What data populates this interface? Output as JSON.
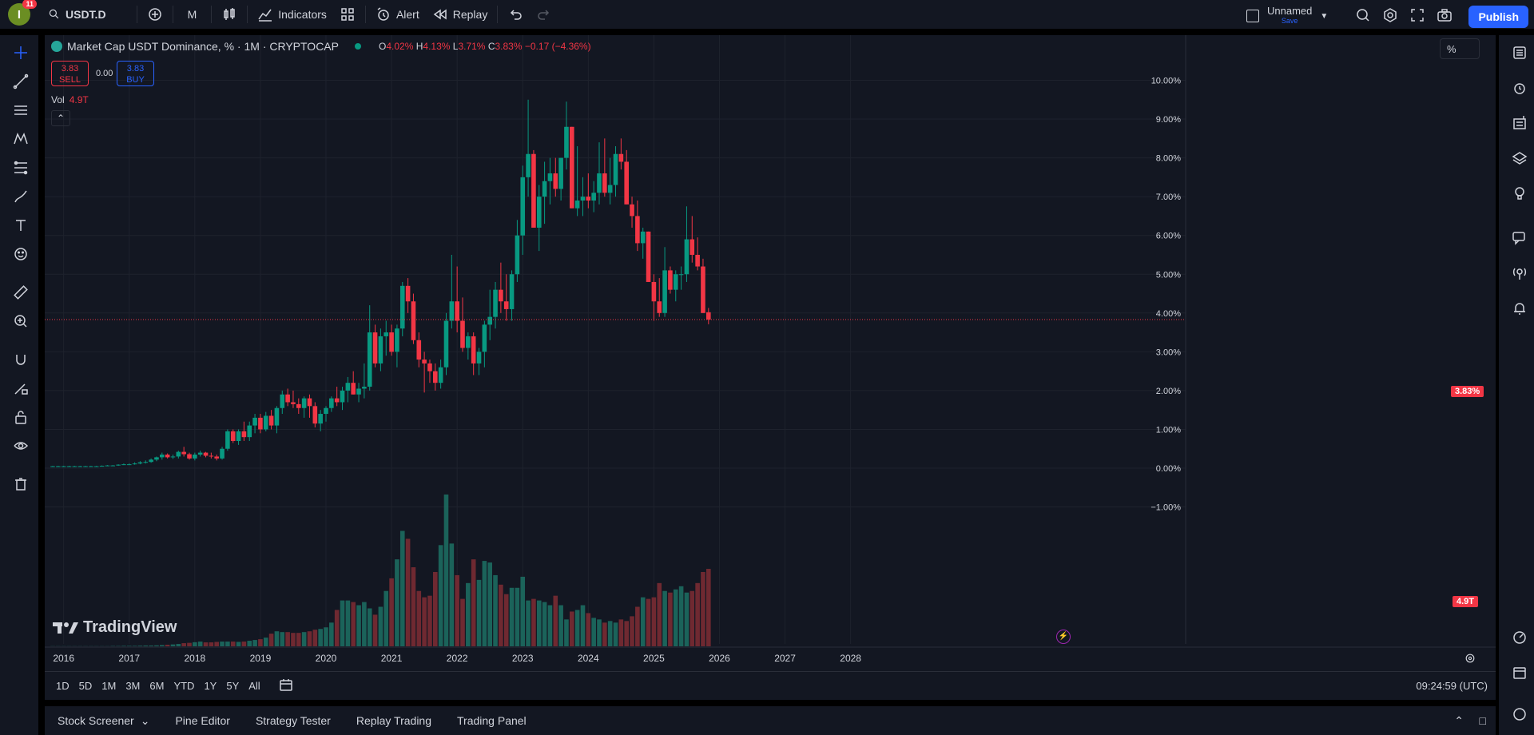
{
  "topbar": {
    "avatar_letter": "I",
    "notif_count": "11",
    "symbol": "USDT.D",
    "interval": "M",
    "indicators_label": "Indicators",
    "alert_label": "Alert",
    "replay_label": "Replay",
    "layout_name": "Unnamed",
    "save_label": "Save",
    "publish_label": "Publish"
  },
  "legend": {
    "title": "Market Cap USDT Dominance, % · 1M · CRYPTOCAP",
    "o_label": "O",
    "o": "4.02%",
    "h_label": "H",
    "h": "4.13%",
    "l_label": "L",
    "l": "3.71%",
    "c_label": "C",
    "c": "3.83%",
    "change": "−0.17 (−4.36%)",
    "sell_price": "3.83",
    "sell_label": "SELL",
    "buy_price": "3.83",
    "buy_label": "BUY",
    "spread": "0.00",
    "vol_label": "Vol",
    "vol_value": "4.9T",
    "scale_mode": "%",
    "logo_text": "TradingView"
  },
  "price_axis": {
    "labels": [
      "10.00%",
      "9.00%",
      "8.00%",
      "7.00%",
      "6.00%",
      "5.00%",
      "4.00%",
      "3.00%",
      "2.00%",
      "1.00%",
      "0.00%",
      "−1.00%"
    ],
    "last_price_tag": "3.83%",
    "volume_tag": "4.9T"
  },
  "time_axis": {
    "labels": [
      "2016",
      "2017",
      "2018",
      "2019",
      "2020",
      "2021",
      "2022",
      "2023",
      "2024",
      "2025",
      "2026",
      "2027",
      "2028"
    ]
  },
  "rangebar": {
    "ranges": [
      "1D",
      "5D",
      "1M",
      "3M",
      "6M",
      "YTD",
      "1Y",
      "5Y",
      "All"
    ],
    "clock": "09:24:59 (UTC)"
  },
  "bottom_tabs": [
    "Stock Screener",
    "Pine Editor",
    "Strategy Tester",
    "Replay Trading",
    "Trading Panel"
  ],
  "colors": {
    "up": "#089981",
    "down": "#f23645",
    "bg": "#131722",
    "grid": "#1e222d",
    "accent": "#2962ff"
  },
  "chart_data": {
    "type": "candlestick",
    "ylim": [
      -1.5,
      11
    ],
    "start": "2015-11",
    "candles": [
      [
        0.05,
        0.06,
        0.04,
        0.05
      ],
      [
        0.05,
        0.06,
        0.04,
        0.05
      ],
      [
        0.05,
        0.06,
        0.04,
        0.05
      ],
      [
        0.05,
        0.06,
        0.04,
        0.05
      ],
      [
        0.05,
        0.06,
        0.04,
        0.05
      ],
      [
        0.05,
        0.06,
        0.04,
        0.05
      ],
      [
        0.05,
        0.06,
        0.04,
        0.05
      ],
      [
        0.05,
        0.06,
        0.04,
        0.05
      ],
      [
        0.05,
        0.06,
        0.04,
        0.05
      ],
      [
        0.05,
        0.07,
        0.04,
        0.06
      ],
      [
        0.06,
        0.08,
        0.05,
        0.07
      ],
      [
        0.07,
        0.08,
        0.06,
        0.07
      ],
      [
        0.07,
        0.1,
        0.06,
        0.09
      ],
      [
        0.09,
        0.12,
        0.08,
        0.1
      ],
      [
        0.1,
        0.12,
        0.09,
        0.1
      ],
      [
        0.1,
        0.15,
        0.09,
        0.12
      ],
      [
        0.12,
        0.18,
        0.1,
        0.15
      ],
      [
        0.15,
        0.2,
        0.12,
        0.16
      ],
      [
        0.16,
        0.25,
        0.14,
        0.22
      ],
      [
        0.22,
        0.3,
        0.18,
        0.28
      ],
      [
        0.28,
        0.4,
        0.22,
        0.35
      ],
      [
        0.35,
        0.38,
        0.25,
        0.28
      ],
      [
        0.28,
        0.35,
        0.24,
        0.3
      ],
      [
        0.3,
        0.45,
        0.25,
        0.42
      ],
      [
        0.42,
        0.55,
        0.3,
        0.36
      ],
      [
        0.36,
        0.4,
        0.22,
        0.25
      ],
      [
        0.25,
        0.4,
        0.2,
        0.35
      ],
      [
        0.35,
        0.45,
        0.3,
        0.4
      ],
      [
        0.4,
        0.42,
        0.28,
        0.32
      ],
      [
        0.32,
        0.4,
        0.25,
        0.3
      ],
      [
        0.3,
        0.35,
        0.2,
        0.25
      ],
      [
        0.25,
        0.55,
        0.22,
        0.5
      ],
      [
        0.5,
        1.0,
        0.45,
        0.95
      ],
      [
        0.95,
        1.0,
        0.65,
        0.7
      ],
      [
        0.7,
        1.0,
        0.6,
        0.95
      ],
      [
        0.95,
        1.2,
        0.7,
        0.8
      ],
      [
        0.8,
        1.2,
        0.7,
        1.1
      ],
      [
        1.1,
        1.4,
        0.9,
        1.3
      ],
      [
        1.3,
        1.4,
        0.9,
        1.0
      ],
      [
        1.0,
        1.45,
        0.95,
        1.35
      ],
      [
        1.35,
        1.5,
        1.0,
        1.1
      ],
      [
        1.1,
        1.6,
        0.9,
        1.55
      ],
      [
        1.55,
        2.0,
        1.4,
        1.9
      ],
      [
        1.9,
        2.05,
        1.6,
        1.7
      ],
      [
        1.7,
        2.0,
        1.55,
        1.65
      ],
      [
        1.65,
        1.8,
        1.4,
        1.55
      ],
      [
        1.55,
        1.85,
        1.3,
        1.8
      ],
      [
        1.8,
        1.9,
        1.3,
        1.6
      ],
      [
        1.6,
        1.7,
        1.05,
        1.15
      ],
      [
        1.15,
        1.5,
        0.95,
        1.4
      ],
      [
        1.4,
        1.6,
        1.2,
        1.55
      ],
      [
        1.55,
        1.85,
        1.45,
        1.8
      ],
      [
        1.8,
        2.1,
        1.6,
        1.7
      ],
      [
        1.7,
        2.1,
        1.5,
        2.0
      ],
      [
        2.0,
        2.35,
        1.7,
        2.2
      ],
      [
        2.2,
        2.5,
        1.9,
        1.9
      ],
      [
        1.9,
        2.2,
        1.7,
        2.05
      ],
      [
        2.05,
        2.7,
        1.8,
        2.1
      ],
      [
        2.1,
        4.2,
        2.0,
        3.5
      ],
      [
        3.5,
        3.7,
        2.6,
        2.7
      ],
      [
        2.7,
        3.6,
        2.5,
        3.4
      ],
      [
        3.4,
        3.8,
        2.9,
        3.5
      ],
      [
        3.5,
        3.7,
        2.9,
        3.0
      ],
      [
        3.0,
        3.7,
        2.6,
        3.6
      ],
      [
        3.6,
        4.8,
        3.4,
        4.7
      ],
      [
        4.7,
        4.9,
        4.0,
        4.3
      ],
      [
        4.3,
        4.5,
        3.2,
        3.3
      ],
      [
        3.3,
        3.5,
        2.6,
        2.8
      ],
      [
        2.8,
        3.0,
        1.95,
        2.7
      ],
      [
        2.7,
        2.8,
        2.2,
        2.5
      ],
      [
        2.5,
        2.7,
        2.0,
        2.2
      ],
      [
        2.2,
        2.8,
        2.05,
        2.6
      ],
      [
        2.6,
        4.0,
        2.4,
        3.8
      ],
      [
        3.8,
        5.5,
        3.6,
        4.3
      ],
      [
        4.3,
        5.2,
        3.5,
        3.8
      ],
      [
        3.8,
        4.4,
        3.0,
        3.1
      ],
      [
        3.1,
        3.5,
        2.8,
        3.4
      ],
      [
        3.4,
        3.5,
        2.4,
        2.7
      ],
      [
        2.7,
        3.1,
        2.4,
        3.0
      ],
      [
        3.0,
        3.8,
        2.6,
        3.7
      ],
      [
        3.7,
        4.6,
        3.3,
        3.9
      ],
      [
        3.9,
        4.8,
        3.6,
        4.6
      ],
      [
        4.6,
        5.3,
        4.0,
        4.3
      ],
      [
        4.3,
        5.0,
        3.8,
        4.1
      ],
      [
        4.1,
        5.1,
        3.8,
        5.0
      ],
      [
        5.0,
        6.4,
        4.8,
        6.0
      ],
      [
        6.0,
        7.8,
        5.5,
        7.5
      ],
      [
        7.5,
        9.5,
        7.0,
        8.1
      ],
      [
        8.1,
        8.2,
        6.2,
        6.2
      ],
      [
        6.2,
        7.3,
        5.6,
        7.0
      ],
      [
        7.0,
        7.9,
        6.3,
        7.4
      ],
      [
        7.4,
        8.0,
        6.8,
        7.6
      ],
      [
        7.6,
        8.0,
        7.0,
        7.2
      ],
      [
        7.2,
        8.0,
        6.9,
        8.0
      ],
      [
        8.0,
        9.45,
        7.7,
        8.8
      ],
      [
        8.8,
        8.8,
        6.7,
        6.7
      ],
      [
        6.7,
        8.3,
        6.5,
        6.9
      ],
      [
        6.9,
        7.5,
        6.5,
        7.0
      ],
      [
        7.0,
        7.6,
        6.7,
        6.9
      ],
      [
        6.9,
        7.4,
        6.6,
        7.1
      ],
      [
        7.1,
        8.4,
        6.8,
        7.6
      ],
      [
        7.6,
        8.5,
        7.0,
        7.1
      ],
      [
        7.1,
        8.0,
        6.8,
        7.3
      ],
      [
        7.3,
        8.3,
        7.0,
        8.1
      ],
      [
        8.1,
        8.5,
        7.7,
        7.9
      ],
      [
        7.9,
        8.2,
        6.8,
        6.8
      ],
      [
        6.8,
        7.0,
        6.2,
        6.5
      ],
      [
        6.5,
        6.9,
        5.6,
        5.8
      ],
      [
        5.8,
        6.2,
        5.4,
        6.1
      ],
      [
        6.1,
        6.1,
        4.8,
        4.8
      ],
      [
        4.8,
        5.0,
        3.8,
        4.3
      ],
      [
        4.3,
        4.9,
        3.9,
        4.0
      ],
      [
        4.0,
        5.7,
        3.9,
        5.1
      ],
      [
        5.1,
        5.2,
        4.5,
        4.6
      ],
      [
        4.6,
        5.1,
        4.3,
        5.0
      ],
      [
        5.0,
        5.2,
        4.6,
        5.0
      ],
      [
        5.0,
        6.75,
        4.8,
        5.9
      ],
      [
        5.9,
        6.5,
        5.3,
        5.5
      ],
      [
        5.5,
        5.95,
        5.1,
        5.2
      ],
      [
        5.2,
        5.4,
        4.0,
        4.0
      ],
      [
        4.02,
        4.13,
        3.71,
        3.83
      ]
    ],
    "volume_trillions": [
      0.01,
      0.01,
      0.01,
      0.01,
      0.01,
      0.01,
      0.01,
      0.01,
      0.01,
      0.01,
      0.01,
      0.02,
      0.02,
      0.03,
      0.03,
      0.03,
      0.04,
      0.05,
      0.05,
      0.06,
      0.08,
      0.1,
      0.12,
      0.15,
      0.2,
      0.22,
      0.26,
      0.3,
      0.25,
      0.25,
      0.28,
      0.3,
      0.3,
      0.3,
      0.28,
      0.3,
      0.35,
      0.4,
      0.45,
      0.55,
      0.8,
      0.95,
      0.9,
      0.9,
      0.85,
      0.85,
      0.9,
      0.95,
      1.05,
      1.1,
      1.2,
      1.5,
      2.3,
      2.9,
      2.9,
      2.8,
      2.6,
      2.8,
      2.4,
      2.0,
      2.5,
      3.5,
      4.3,
      5.5,
      7.3,
      6.8,
      5.0,
      3.5,
      3.1,
      3.2,
      4.7,
      6.4,
      9.6,
      6.5,
      4.5,
      3.0,
      4.0,
      5.5,
      4.2,
      5.4,
      5.3,
      4.5,
      3.9,
      3.3,
      3.7,
      3.7,
      4.4,
      2.9,
      3.0,
      2.9,
      2.8,
      2.6,
      3.2,
      2.6,
      1.7,
      2.2,
      2.3,
      2.6,
      2.1,
      1.8,
      1.7,
      1.5,
      1.6,
      1.5,
      1.7,
      1.6,
      1.9,
      2.5,
      3.1,
      3.0,
      3.1,
      4.0,
      3.5,
      3.4,
      3.6,
      3.8,
      3.4,
      3.5,
      4.0,
      4.7,
      4.9
    ]
  }
}
